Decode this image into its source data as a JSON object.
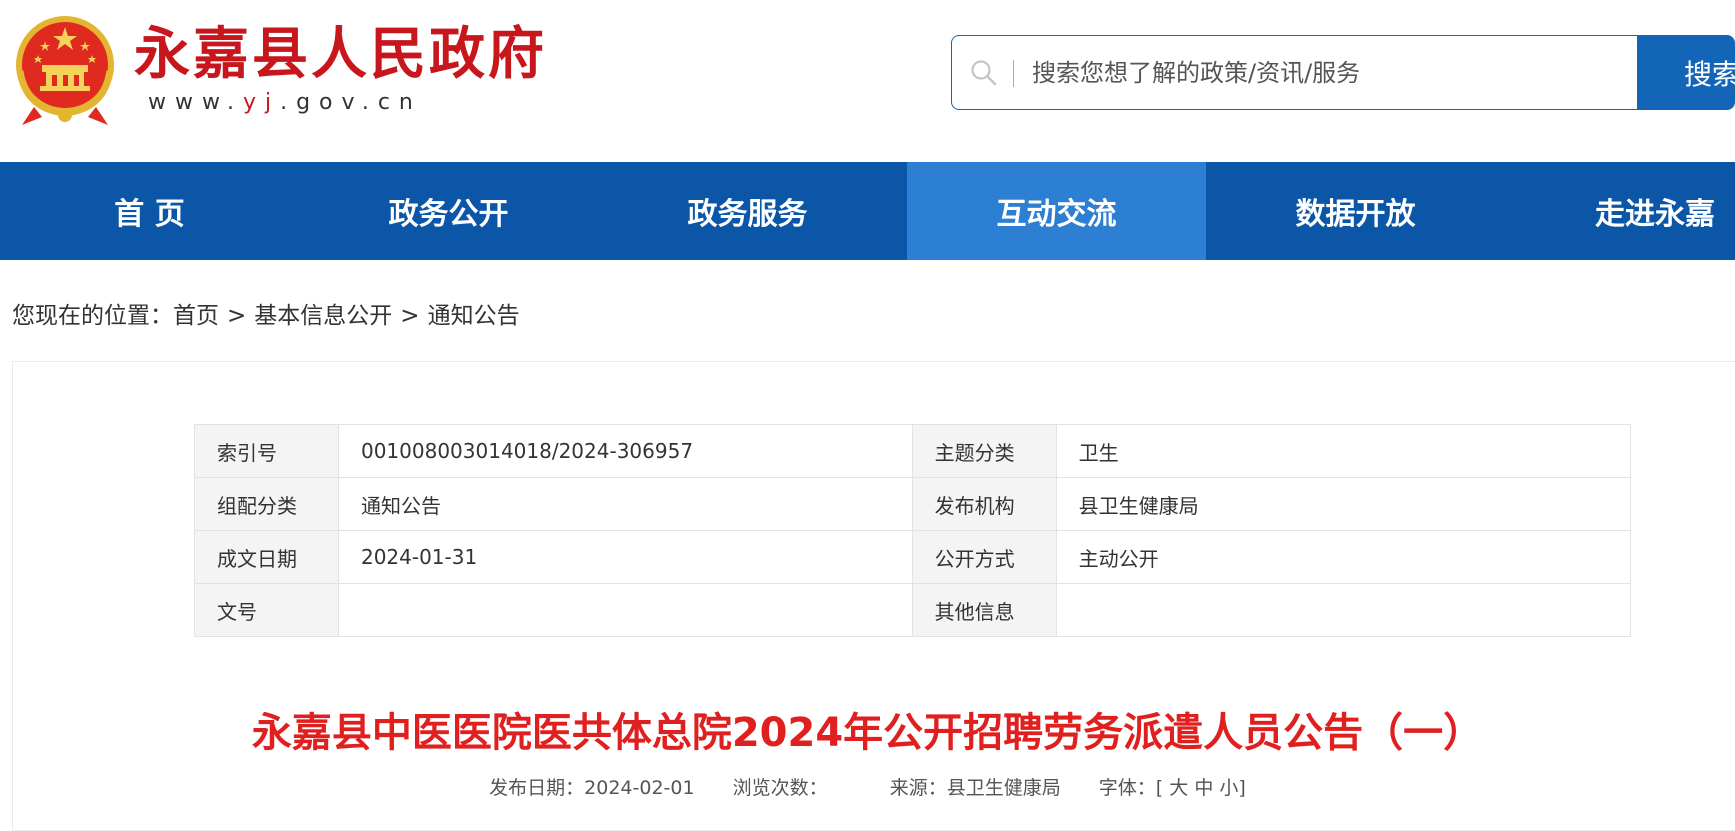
{
  "header": {
    "site_title": "永嘉县人民政府",
    "site_url_prefix": "www.",
    "site_url_highlight": "yj",
    "site_url_suffix": ".gov.cn",
    "emblem_icon": "national-emblem-icon",
    "brand_color": "#c8161d"
  },
  "search": {
    "placeholder": "搜索您想了解的政策/资讯/服务",
    "button_label": "搜索",
    "icon": "search-icon",
    "accent": "#1265b7"
  },
  "nav": {
    "items": [
      {
        "label": "首 页",
        "active": false
      },
      {
        "label": "政务公开",
        "active": false
      },
      {
        "label": "政务服务",
        "active": false
      },
      {
        "label": "互动交流",
        "active": true
      },
      {
        "label": "数据开放",
        "active": false
      },
      {
        "label": "走进永嘉",
        "active": false
      }
    ],
    "background": "#0b56a6",
    "active_background": "#2c7fd2"
  },
  "breadcrumb": {
    "prefix": "您现在的位置：",
    "items": [
      "首页",
      "基本信息公开",
      "通知公告"
    ],
    "separator": ">"
  },
  "meta_table": {
    "rows": [
      [
        {
          "label": "索引号",
          "value": "001008003014018/2024-306957"
        },
        {
          "label": "主题分类",
          "value": "卫生"
        }
      ],
      [
        {
          "label": "组配分类",
          "value": "通知公告"
        },
        {
          "label": "发布机构",
          "value": "县卫生健康局"
        }
      ],
      [
        {
          "label": "成文日期",
          "value": "2024-01-31"
        },
        {
          "label": "公开方式",
          "value": "主动公开"
        }
      ],
      [
        {
          "label": "文号",
          "value": ""
        },
        {
          "label": "其他信息",
          "value": ""
        }
      ]
    ]
  },
  "article": {
    "title": "永嘉县中医医院医共体总院2024年公开招聘劳务派遣人员公告（一）",
    "title_color": "#e01f1f",
    "publish_date_label": "发布日期：",
    "publish_date": "2024-02-01",
    "views_label": "浏览次数：",
    "views_value": "",
    "source_label": "来源：",
    "source": "县卫生健康局",
    "font_size_label": "字体：",
    "font_open": "[",
    "font_large": "大",
    "font_medium": "中",
    "font_small": "小",
    "font_close": "]"
  }
}
